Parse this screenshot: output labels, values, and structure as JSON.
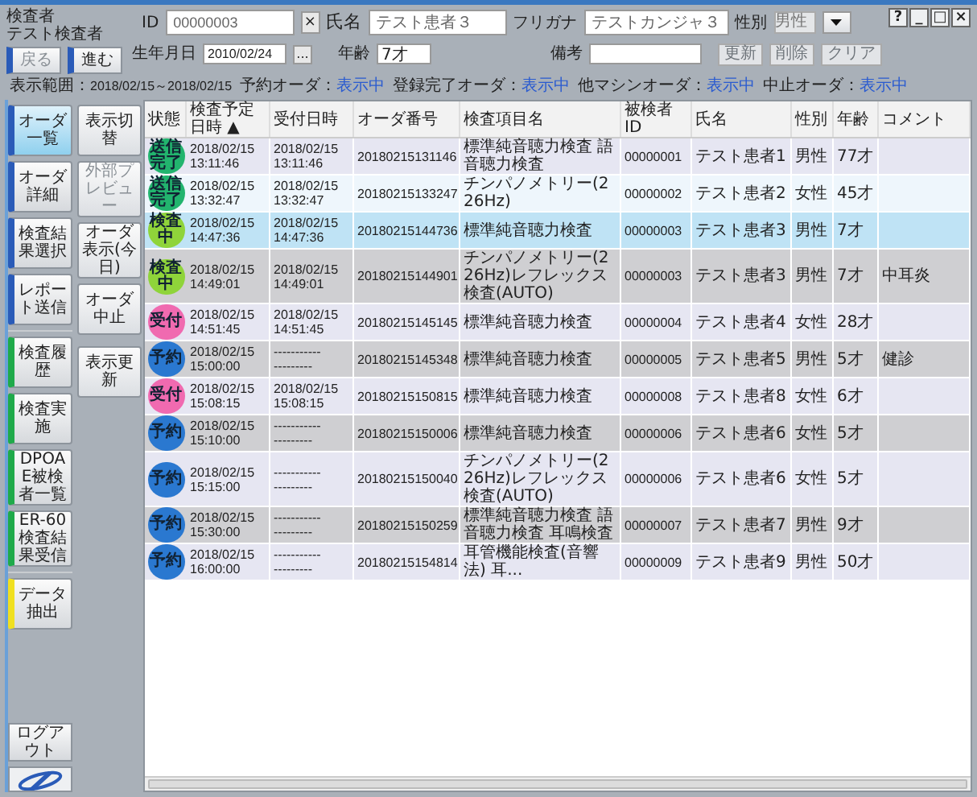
{
  "user": {
    "label": "検査者",
    "name": "テスト検査者"
  },
  "nav_buttons": [
    {
      "label": "戻る",
      "disabled": true
    },
    {
      "label": "進む",
      "disabled": false
    }
  ],
  "patient_form": {
    "id_label": "ID",
    "id": "00000003",
    "clear": "×",
    "name_label": "氏名",
    "name": "テスト患者３",
    "kana_label": "フリガナ",
    "kana": "テストカンジャ３",
    "sex_label": "性別",
    "sex": "男性",
    "birth_label": "生年月日",
    "birth": "2010/02/24",
    "birth_picker": "...",
    "age_label": "年齢",
    "age": "7才",
    "note_label": "備考"
  },
  "form_buttons": [
    {
      "label": "更新",
      "disabled": true
    },
    {
      "label": "削除",
      "disabled": true
    },
    {
      "label": "クリア",
      "disabled": true
    }
  ],
  "window_controls": [
    "?",
    "_",
    "□",
    "×"
  ],
  "filters": {
    "range_label": "表示範囲：",
    "range": "2018/02/15～2018/02/15",
    "items": [
      {
        "label": "予約オーダ：",
        "value": "表示中"
      },
      {
        "label": "登録完了オーダ：",
        "value": "表示中"
      },
      {
        "label": "他マシンオーダ：",
        "value": "表示中"
      },
      {
        "label": "中止オーダ：",
        "value": "表示中"
      }
    ]
  },
  "sidebar_groups": [
    [
      {
        "label": "オーダ一覧",
        "selected": true,
        "color": "#2a5bb8"
      },
      {
        "label": "オーダ詳細",
        "selected": false,
        "color": "#2a5bb8"
      },
      {
        "label": "検査結果選択",
        "selected": false,
        "color": "#2a5bb8"
      },
      {
        "label": "レポート送信",
        "selected": false,
        "color": "#2a5bb8"
      }
    ],
    [
      {
        "label": "検査履歴",
        "selected": false,
        "color": "#1faa4a"
      },
      {
        "label": "検査実施",
        "selected": false,
        "color": "#1faa4a"
      },
      {
        "label": "DPOAE被検者一覧",
        "selected": false,
        "color": "#1faa4a"
      },
      {
        "label": "ER-60検査結果受信",
        "selected": false,
        "color": "#1faa4a"
      }
    ],
    [
      {
        "label": "データ抽出",
        "selected": false,
        "color": "#f0e020"
      }
    ]
  ],
  "logout": "ログアウト",
  "action_groups": [
    [
      {
        "label": "表示切替",
        "disabled": false
      },
      {
        "label": "外部プレビュー",
        "disabled": true
      },
      {
        "label": "オーダ表示(今日)",
        "disabled": false
      },
      {
        "label": "オーダ中止",
        "disabled": false
      }
    ],
    [
      {
        "label": "表示更新",
        "disabled": false
      }
    ]
  ],
  "table": {
    "columns": [
      "状態",
      "検査予定日時 ▲",
      "受付日時",
      "オーダ番号",
      "検査項目名",
      "被検者ID",
      "氏名",
      "性別",
      "年齢",
      "コメント"
    ],
    "rows": [
      {
        "status": "送信完了",
        "color": "#22b46e",
        "scheduled": "2018/02/15\n13:11:46",
        "received": "2018/02/15\n13:11:46",
        "order": "20180215131146",
        "item": "標準純音聴力検査 語音聴力検査",
        "pid": "00000001",
        "name": "テスト患者1",
        "sex": "男性",
        "age": "77才",
        "selected": false,
        "hovered": false
      },
      {
        "status": "送信完了",
        "color": "#22b46e",
        "scheduled": "2018/02/15\n13:32:47",
        "received": "2018/02/15\n13:32:47",
        "order": "20180215133247",
        "item": "チンパノメトリー(226Hz)",
        "pid": "00000002",
        "name": "テスト患者2",
        "sex": "女性",
        "age": "45才",
        "selected": false,
        "hovered": true
      },
      {
        "status": "検査中",
        "color": "#8fd43a",
        "scheduled": "2018/02/15\n14:47:36",
        "received": "2018/02/15\n14:47:36",
        "order": "20180215144736",
        "item": "標準純音聴力検査",
        "pid": "00000003",
        "name": "テスト患者3",
        "sex": "男性",
        "age": "7才",
        "selected": true,
        "hovered": false
      },
      {
        "status": "検査中",
        "color": "#8fd43a",
        "scheduled": "2018/02/15\n14:49:01",
        "received": "2018/02/15\n14:49:01",
        "order": "20180215144901",
        "item": "チンパノメトリー(226Hz)レフレックス検査(AUTO)",
        "pid": "00000003",
        "name": "テスト患者3",
        "sex": "男性",
        "age": "7才",
        "comment": "中耳炎",
        "selected": false,
        "hovered": false
      },
      {
        "status": "受付",
        "color": "#f06ab0",
        "scheduled": "2018/02/15\n14:51:45",
        "received": "2018/02/15\n14:51:45",
        "order": "20180215145145",
        "item": "標準純音聴力検査",
        "pid": "00000004",
        "name": "テスト患者4",
        "sex": "女性",
        "age": "28才",
        "selected": false,
        "hovered": false
      },
      {
        "status": "予約",
        "color": "#2a78d0",
        "scheduled": "2018/02/15\n15:00:00",
        "received": "-----------\n---------",
        "order": "20180215145348",
        "item": "標準純音聴力検査",
        "pid": "00000005",
        "name": "テスト患者5",
        "sex": "男性",
        "age": "5才",
        "comment": "健診",
        "selected": false,
        "hovered": false
      },
      {
        "status": "受付",
        "color": "#f06ab0",
        "scheduled": "2018/02/15\n15:08:15",
        "received": "2018/02/15\n15:08:15",
        "order": "20180215150815",
        "item": "標準純音聴力検査",
        "pid": "00000008",
        "name": "テスト患者8",
        "sex": "女性",
        "age": "6才",
        "selected": false,
        "hovered": false
      },
      {
        "status": "予約",
        "color": "#2a78d0",
        "scheduled": "2018/02/15\n15:10:00",
        "received": "-----------\n---------",
        "order": "20180215150006",
        "item": "標準純音聴力検査",
        "pid": "00000006",
        "name": "テスト患者6",
        "sex": "女性",
        "age": "5才",
        "selected": false,
        "hovered": false
      },
      {
        "status": "予約",
        "color": "#2a78d0",
        "scheduled": "2018/02/15\n15:15:00",
        "received": "-----------\n---------",
        "order": "20180215150040",
        "item": "チンパノメトリー(226Hz)レフレックス検査(AUTO)",
        "pid": "00000006",
        "name": "テスト患者6",
        "sex": "女性",
        "age": "5才",
        "selected": false,
        "hovered": false
      },
      {
        "status": "予約",
        "color": "#2a78d0",
        "scheduled": "2018/02/15\n15:30:00",
        "received": "-----------\n---------",
        "order": "20180215150259",
        "item": "標準純音聴力検査 語音聴力検査 耳鳴検査",
        "pid": "00000007",
        "name": "テスト患者7",
        "sex": "男性",
        "age": "9才",
        "selected": false,
        "hovered": false
      },
      {
        "status": "予約",
        "color": "#2a78d0",
        "scheduled": "2018/02/15\n16:00:00",
        "received": "-----------\n---------",
        "order": "20180215154814",
        "item": "耳管機能検査(音響法) 耳...",
        "pid": "00000009",
        "name": "テスト患者9",
        "sex": "男性",
        "age": "50才",
        "selected": false,
        "hovered": false
      }
    ]
  }
}
